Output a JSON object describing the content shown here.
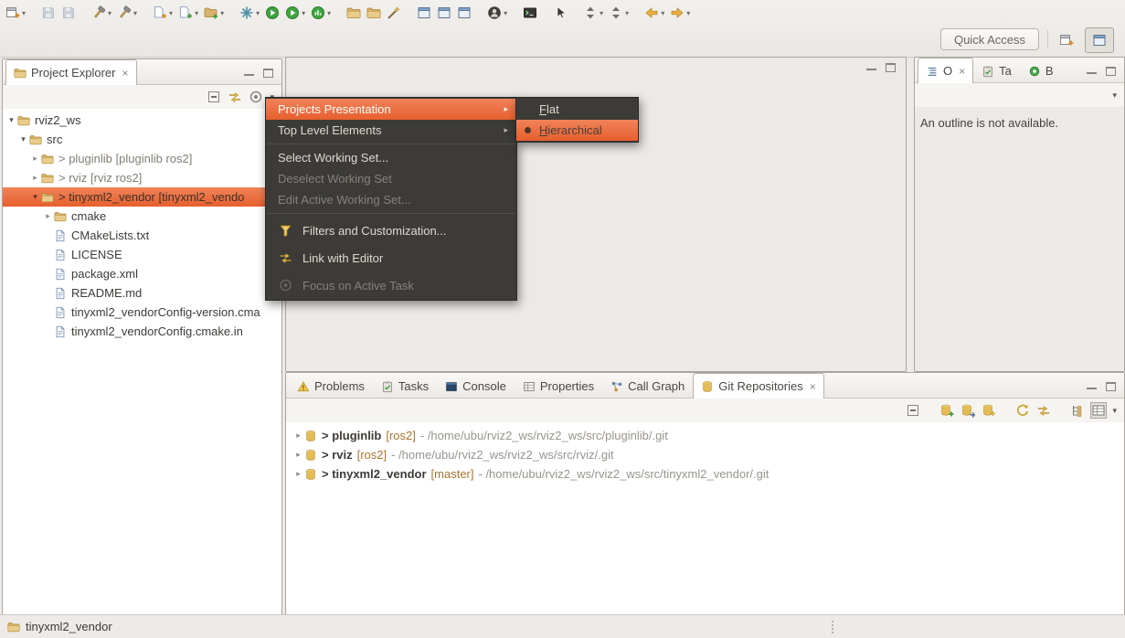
{
  "colors": {
    "accent": "#ED6F3F",
    "accent-top": "#F0835A",
    "accent-bottom": "#E75F2D",
    "menu-bg": "#3C3B37",
    "menu-fg": "#DFDBD2",
    "menu-disabled": "#86827B",
    "window-bg": "#EDEAE7",
    "panel-border": "#A9A59F",
    "branch": "#A9742F",
    "path": "#98948D"
  },
  "toolbar": {
    "quick_access_label": "Quick Access",
    "icons": [
      "new-wizard",
      "save",
      "save-all",
      "build",
      "build-all",
      "new-source-file",
      "new-class",
      "new-folder",
      "debug",
      "resume",
      "run",
      "profile",
      "open-folder",
      "open-project",
      "search-wand",
      "open-console-view",
      "open-editor-view",
      "open-outline-view",
      "user-menu",
      "terminal",
      "select-pointer",
      "next-annotation",
      "previous-annotation",
      "back",
      "forward"
    ],
    "perspective_icons": [
      "open-perspective",
      "cpp-perspective"
    ]
  },
  "project_explorer": {
    "tab_title": "Project Explorer",
    "tree": [
      {
        "label": "rviz2_ws"
      },
      {
        "label": "src"
      },
      {
        "label": "> pluginlib [pluginlib ros2]"
      },
      {
        "label": "> rviz [rviz ros2]"
      },
      {
        "label": "> tinyxml2_vendor [tinyxml2_vendo"
      },
      {
        "label": "cmake"
      },
      {
        "label": "CMakeLists.txt"
      },
      {
        "label": "LICENSE"
      },
      {
        "label": "package.xml"
      },
      {
        "label": "README.md"
      },
      {
        "label": "tinyxml2_vendorConfig-version.cma"
      },
      {
        "label": "tinyxml2_vendorConfig.cmake.in"
      }
    ]
  },
  "view_menu": {
    "items": [
      {
        "label": "Projects Presentation"
      },
      {
        "label": "Top Level Elements"
      },
      {
        "label": "Select Working Set..."
      },
      {
        "label": "Deselect Working Set"
      },
      {
        "label": "Edit Active Working Set..."
      },
      {
        "label": "Filters and Customization..."
      },
      {
        "label": "Link with Editor"
      },
      {
        "label": "Focus on Active Task"
      }
    ],
    "submenu": {
      "flat_initial": "F",
      "flat_rest": "lat",
      "hierarchical_initial": "H",
      "hierarchical_rest": "ierarchical"
    }
  },
  "outline_panel": {
    "tabs": [
      {
        "label": "O"
      },
      {
        "label": "Ta"
      },
      {
        "label": "B"
      }
    ],
    "message": "An outline is not available."
  },
  "bottom_panel": {
    "tabs": [
      {
        "label": "Problems"
      },
      {
        "label": "Tasks"
      },
      {
        "label": "Console"
      },
      {
        "label": "Properties"
      },
      {
        "label": "Call Graph"
      },
      {
        "label": "Git Repositories"
      }
    ],
    "repositories": [
      {
        "name": "> pluginlib",
        "branch": "[ros2]",
        "path": "- /home/ubu/rviz2_ws/rviz2_ws/src/pluginlib/.git"
      },
      {
        "name": "> rviz",
        "branch": "[ros2]",
        "path": "- /home/ubu/rviz2_ws/rviz2_ws/src/rviz/.git"
      },
      {
        "name": "> tinyxml2_vendor",
        "branch": "[master]",
        "path": "- /home/ubu/rviz2_ws/rviz2_ws/src/tinyxml2_vendor/.git"
      }
    ]
  },
  "statusbar": {
    "selection": "tinyxml2_vendor"
  }
}
